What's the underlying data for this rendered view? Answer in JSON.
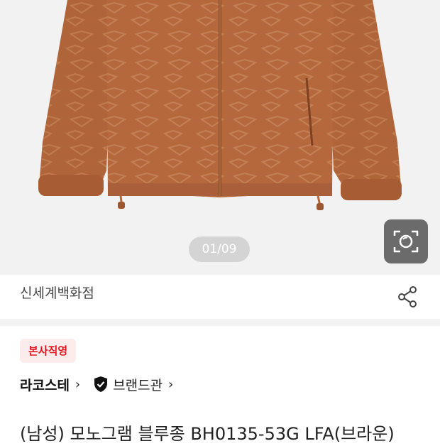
{
  "gallery": {
    "counter": "01/09",
    "lens_icon": "camera-lens-icon"
  },
  "store": {
    "name": "신세계백화점",
    "share_icon": "share-icon"
  },
  "product": {
    "badge": "본사직영",
    "brand": "라코스테",
    "brand_shop_label": "브랜드관",
    "title": "(남성) 모노그램 블루종 BH0135-53G LFA(브라운)"
  },
  "colors": {
    "accent_red": "#e0161e",
    "badge_bg": "#fdecec",
    "jacket_brown": "#b5683c"
  }
}
